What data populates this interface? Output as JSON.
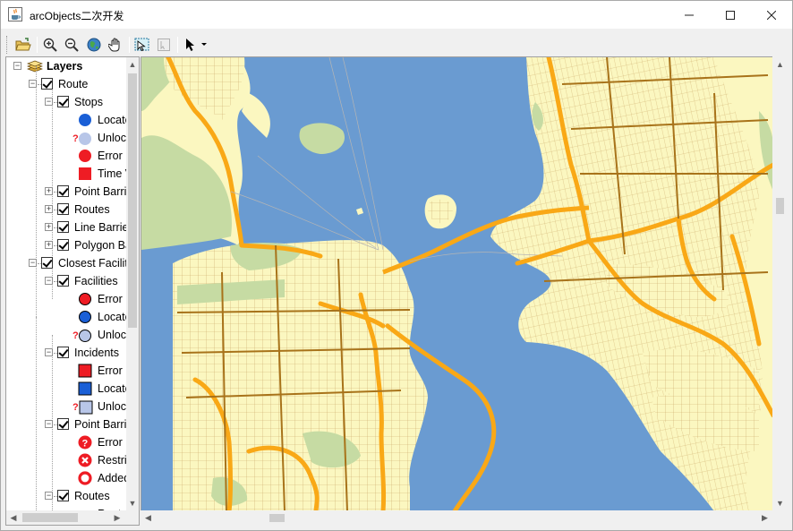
{
  "window": {
    "title": "arcObjects二次开发",
    "controls": [
      "minimize",
      "maximize",
      "close"
    ]
  },
  "toolbar": {
    "buttons": [
      {
        "name": "open-icon"
      },
      {
        "name": "zoom-in-icon"
      },
      {
        "name": "zoom-out-icon"
      },
      {
        "name": "full-extent-globe-icon"
      },
      {
        "name": "pan-hand-icon"
      },
      {
        "name": "select-features-icon"
      },
      {
        "name": "clear-selection-icon"
      },
      {
        "name": "select-pointer-icon"
      }
    ]
  },
  "toc": {
    "root": "Layers",
    "items": [
      {
        "label": "Route",
        "level": 1,
        "type": "group",
        "checked": true
      },
      {
        "label": "Stops",
        "level": 2,
        "type": "group",
        "checked": true
      },
      {
        "label": "Located",
        "level": 3,
        "type": "symbol",
        "symbol": "blue-circle"
      },
      {
        "label": "Unlocated",
        "level": 3,
        "type": "symbol",
        "symbol": "q-lightblue-circle"
      },
      {
        "label": "Error",
        "level": 3,
        "type": "symbol",
        "symbol": "red-circle"
      },
      {
        "label": "Time Violation",
        "level": 3,
        "type": "symbol",
        "symbol": "red-square"
      },
      {
        "label": "Point Barriers",
        "level": 2,
        "type": "collapsed",
        "checked": true
      },
      {
        "label": "Routes",
        "level": 2,
        "type": "collapsed",
        "checked": true
      },
      {
        "label": "Line Barriers",
        "level": 2,
        "type": "collapsed",
        "checked": true
      },
      {
        "label": "Polygon Barriers",
        "level": 2,
        "type": "collapsed",
        "checked": true
      },
      {
        "label": "Closest Facility",
        "level": 1,
        "type": "group",
        "checked": true
      },
      {
        "label": "Facilities",
        "level": 2,
        "type": "group",
        "checked": true
      },
      {
        "label": "Error",
        "level": 3,
        "type": "symbol",
        "symbol": "red-circle-outlined"
      },
      {
        "label": "Located",
        "level": 3,
        "type": "symbol",
        "symbol": "blue-circle-outlined"
      },
      {
        "label": "Unlocated",
        "level": 3,
        "type": "symbol",
        "symbol": "q-gray-circle"
      },
      {
        "label": "Incidents",
        "level": 2,
        "type": "group",
        "checked": true
      },
      {
        "label": "Error",
        "level": 3,
        "type": "symbol",
        "symbol": "red-square-outlined"
      },
      {
        "label": "Located",
        "level": 3,
        "type": "symbol",
        "symbol": "blue-square-outlined"
      },
      {
        "label": "Unlocated",
        "level": 3,
        "type": "symbol",
        "symbol": "q-gray-square"
      },
      {
        "label": "Point Barriers",
        "level": 2,
        "type": "group",
        "checked": true
      },
      {
        "label": "Error",
        "level": 3,
        "type": "symbol",
        "symbol": "red-q-circle"
      },
      {
        "label": "Restricted",
        "level": 3,
        "type": "symbol",
        "symbol": "red-x-circle"
      },
      {
        "label": "Added Cost",
        "level": 3,
        "type": "symbol",
        "symbol": "red-ring"
      },
      {
        "label": "Routes",
        "level": 2,
        "type": "group",
        "checked": true
      },
      {
        "label": "Route",
        "level": 3,
        "type": "symbol",
        "symbol": "partial"
      }
    ]
  },
  "colors": {
    "water": "#6a9bd1",
    "land": "#fbf7c0",
    "park": "#c6dba3",
    "street": "#a8731a",
    "highway": "#f9a816",
    "accent_blue": "#1a5fd6",
    "accent_red": "#ee1c24"
  }
}
